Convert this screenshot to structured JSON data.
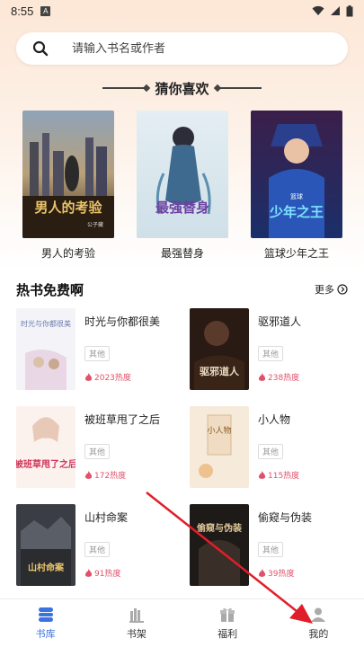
{
  "status_bar": {
    "time": "8:55",
    "app_badge": "A"
  },
  "search": {
    "placeholder": "请输入书名或作者"
  },
  "guess": {
    "title": "猜你喜欢",
    "books": [
      {
        "title": "男人的考验",
        "cover_text": "男人的考验",
        "cover_sub": "公子藏"
      },
      {
        "title": "最强替身",
        "cover_text": "最强替身",
        "cover_sub": ""
      },
      {
        "title": "篮球少年之王",
        "cover_text": "少年之王",
        "cover_sub": "篮球"
      }
    ]
  },
  "hot": {
    "title": "热书免费啊",
    "more_label": "更多",
    "books": [
      {
        "title": "时光与你都很美",
        "tag": "其他",
        "heat": "2023热度",
        "cover_text": "时光与你都很美"
      },
      {
        "title": "驱邪道人",
        "tag": "其他",
        "heat": "238热度",
        "cover_text": "驱邪道人"
      },
      {
        "title": "被班草甩了之后",
        "tag": "其他",
        "heat": "172热度",
        "cover_text": "被班草甩了之后"
      },
      {
        "title": "小人物",
        "tag": "其他",
        "heat": "115热度",
        "cover_text": "小人物"
      },
      {
        "title": "山村命案",
        "tag": "其他",
        "heat": "91热度",
        "cover_text": "山村命案"
      },
      {
        "title": "偷窥与伪装",
        "tag": "其他",
        "heat": "39热度",
        "cover_text": "偷窥与伪装"
      }
    ]
  },
  "nav": {
    "items": [
      {
        "label": "书库",
        "icon": "library-icon",
        "active": true
      },
      {
        "label": "书架",
        "icon": "bookshelf-icon",
        "active": false
      },
      {
        "label": "福利",
        "icon": "gift-icon",
        "active": false
      },
      {
        "label": "我的",
        "icon": "profile-icon",
        "active": false
      }
    ]
  },
  "colors": {
    "accent": "#3b74e0",
    "heat": "#e0526a",
    "arrow": "#e01e2a",
    "top_gradient": "#fde7d6"
  }
}
